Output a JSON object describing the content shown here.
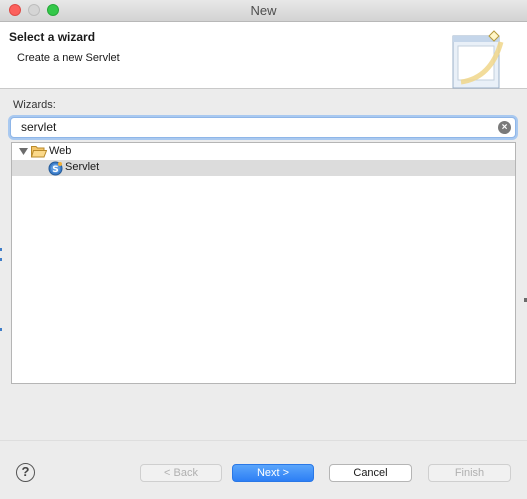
{
  "window": {
    "title": "New"
  },
  "header": {
    "title": "Select a wizard",
    "description": "Create a new Servlet"
  },
  "wizards": {
    "label": "Wizards:",
    "filter_value": "servlet",
    "tree": [
      {
        "label": "Web",
        "icon": "folder-open-icon",
        "expanded": true,
        "children": [
          {
            "label": "Servlet",
            "icon": "servlet-icon",
            "selected": true
          }
        ]
      }
    ]
  },
  "buttons": {
    "help": "?",
    "back": "< Back",
    "next": "Next >",
    "cancel": "Cancel",
    "finish": "Finish"
  },
  "colors": {
    "accent": "#2d7ff5",
    "selection": "#dcdcdc",
    "focus_ring": "#a9c9f0"
  }
}
